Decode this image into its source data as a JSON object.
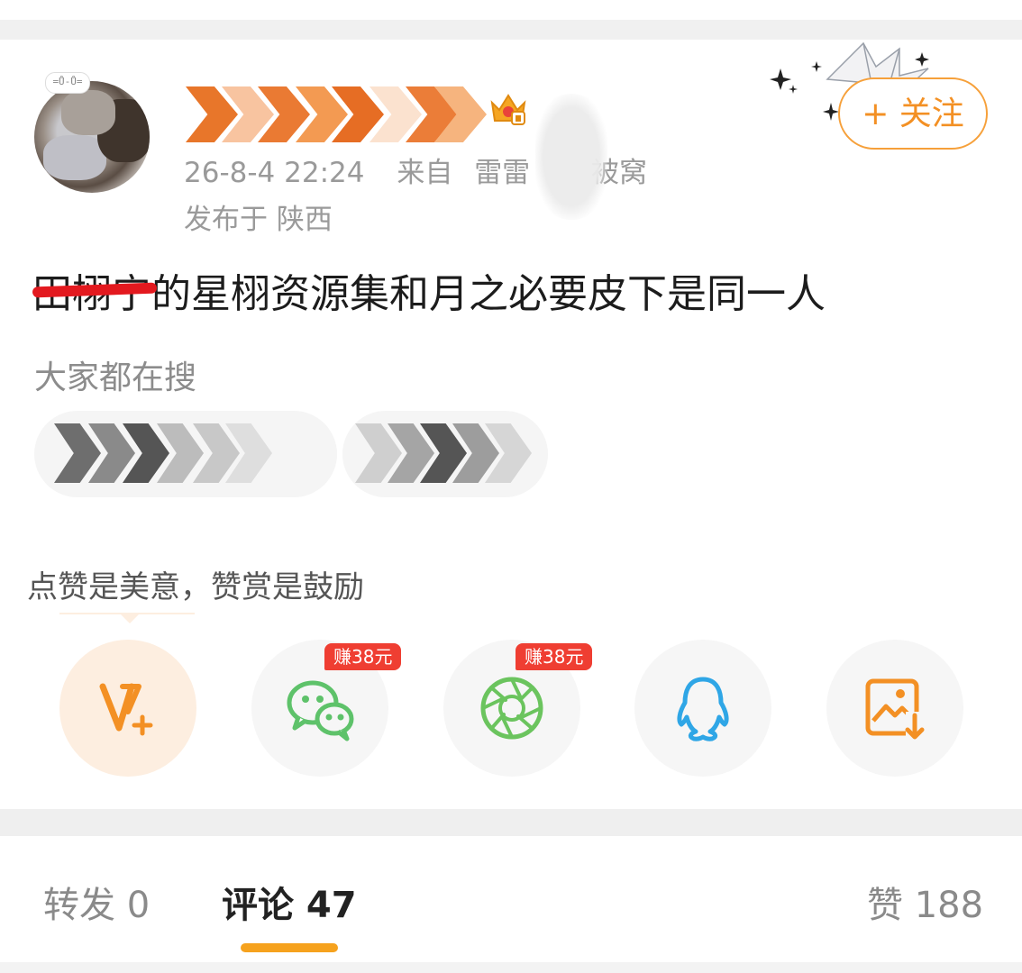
{
  "post": {
    "timestamp": "26-8-4 22:24",
    "source_prefix": "来自",
    "source_app": "雷雷",
    "source_suffix": "被窝",
    "location": "发布于 陕西",
    "text_visible": "的星栩资源集和月之必要皮下是同一人",
    "strikethrough_text": "田栩宁",
    "follow_label": "+ 关注",
    "avatar_tag": "=Ů-Ů="
  },
  "search": {
    "hint": "大家都在搜"
  },
  "reward": {
    "tip": "点赞是美意，赞赏是鼓励"
  },
  "share": [
    {
      "name": "vip-plus",
      "icon": "v-plus-icon",
      "color": "#f39024",
      "badge": ""
    },
    {
      "name": "wechat",
      "icon": "wechat-icon",
      "color": "#5ec26a",
      "badge": "赚38元"
    },
    {
      "name": "moments",
      "icon": "moments-icon",
      "color": "#6bc45e",
      "badge": "赚38元"
    },
    {
      "name": "qq",
      "icon": "qq-icon",
      "color": "#2fa6e6",
      "badge": ""
    },
    {
      "name": "save-image",
      "icon": "save-image-icon",
      "color": "#f39024",
      "badge": ""
    }
  ],
  "tabs": {
    "repost": "转发 0",
    "comments": "评论 47",
    "likes": "赞 188"
  },
  "colors": {
    "accent": "#f39024",
    "strike": "#e3191f",
    "badge": "#ef3e32"
  }
}
